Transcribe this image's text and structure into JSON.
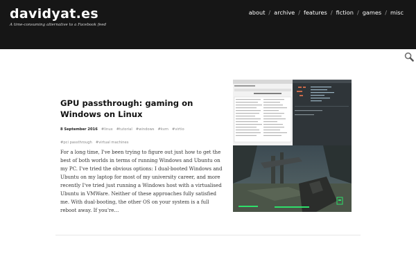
{
  "site": {
    "title": "davidyat.es",
    "tagline": "A time-consuming alternative to a Facebook feed"
  },
  "nav": {
    "items": [
      "about",
      "archive",
      "features",
      "fiction",
      "games",
      "misc"
    ],
    "separator": "/"
  },
  "post": {
    "title": "GPU passthrough: gaming on Windows on Linux",
    "date": "8 September 2016",
    "tags": [
      "#linux",
      "#tutorial",
      "#windows",
      "#kvm",
      "#virtio",
      "#pci passthrough",
      "#virtual machines"
    ],
    "excerpt": "For a long time, I've been trying to figure out just how to get the best of both worlds in terms of running Windows and Ubuntu on my PC. I've tried the obvious options: I dual-booted Windows and Ubuntu on my laptop for most of my university career, and more recently I've tried just running a Windows host with a virtualised Ubuntu in VMWare. Neither of these approaches fully satisfied me. With dual-booting, the other OS on your system is a full reboot away. If you're…"
  },
  "icons": {
    "search": "search-icon",
    "thumbnail": "gpu-passthrough-screenshot"
  },
  "colors": {
    "header_bg": "#161616",
    "header_text": "#ffffff",
    "body_text": "#333333",
    "tag_text": "#8a8a8a",
    "divider": "#e6e6e6"
  }
}
